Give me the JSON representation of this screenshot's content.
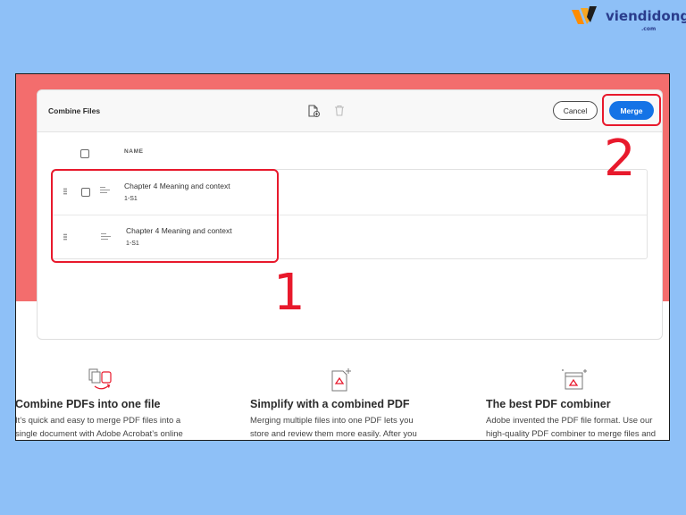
{
  "watermark": {
    "brand": "viendidong",
    "sub": ".com"
  },
  "dialog": {
    "title": "Combine Files",
    "cancel_label": "Cancel",
    "merge_label": "Merge",
    "column_header": "NAME"
  },
  "files": [
    {
      "name": "Chapter 4 Meaning and context",
      "sub": "1-S1"
    },
    {
      "name": "Chapter 4 Meaning and context",
      "sub": "1-S1"
    }
  ],
  "annotations": {
    "step1": "1",
    "step2": "2"
  },
  "features": [
    {
      "title": "Combine PDFs into one file",
      "lines": [
        "It’s quick and easy to merge PDF files into a",
        "single document with Adobe Acrobat’s online"
      ],
      "icon": "combine-files-icon"
    },
    {
      "title": "Simplify with a combined PDF",
      "lines": [
        "Merging multiple files into one PDF lets you",
        "store and review them more easily. After you"
      ],
      "icon": "pdf-document-icon"
    },
    {
      "title": "The best PDF combiner",
      "lines": [
        "Adobe invented the PDF file format. Use our",
        "high-quality PDF combiner to merge files and"
      ],
      "icon": "pdf-sparkle-icon"
    }
  ],
  "colors": {
    "background": "#8ec0f7",
    "red_band": "#f36d6d",
    "accent_blue": "#1473e6",
    "annotation_red": "#e8192c"
  }
}
